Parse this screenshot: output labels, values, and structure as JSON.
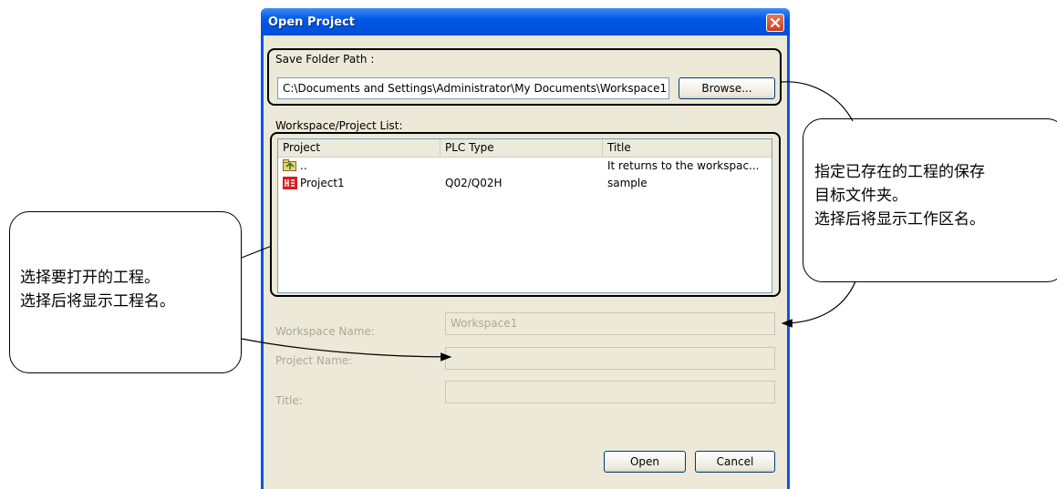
{
  "dialog": {
    "title": "Open Project",
    "save_folder_label": "Save Folder Path :",
    "save_folder_value": "C:\\Documents and Settings\\Administrator\\My Documents\\Workspace1",
    "browse_label": "Browse...",
    "list_label": "Workspace/Project List:",
    "columns": [
      "Project",
      "PLC Type",
      "Title"
    ],
    "rows": [
      {
        "project": "..",
        "plc_type": "",
        "title": "It returns to the workspac...",
        "icon": "folder-up-icon"
      },
      {
        "project": "Project1",
        "plc_type": "Q02/Q02H",
        "title": "sample",
        "icon": "plc-project-icon"
      }
    ],
    "workspace_name_label": "Workspace Name:",
    "workspace_name_value": "Workspace1",
    "project_name_label": "Project Name:",
    "project_name_value": "",
    "title_label": "Title:",
    "title_value": "",
    "open_label": "Open",
    "cancel_label": "Cancel"
  },
  "callouts": {
    "left": [
      "选择要打开的工程。",
      "选择后将显示工程名。"
    ],
    "right": [
      "指定已存在的工程的保存",
      "目标文件夹。",
      "选择后将显示工作区名。"
    ]
  },
  "colors": {
    "titlebar": "#0058e6",
    "dialog_bg": "#ece9d8",
    "close_button": "#d45a3a",
    "disabled_text": "#aca899"
  }
}
